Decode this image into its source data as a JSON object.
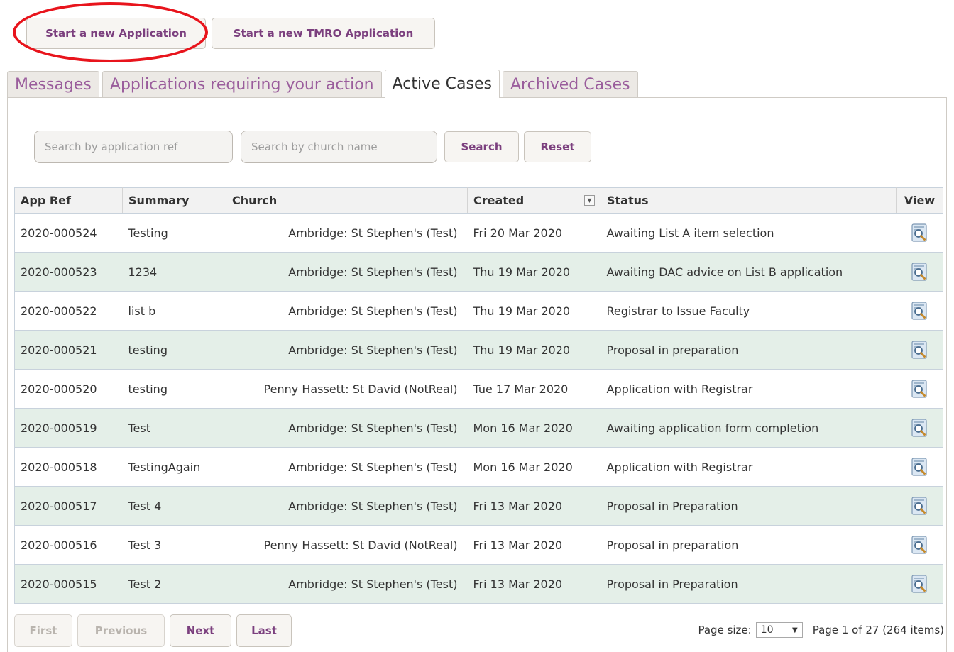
{
  "toolbar": {
    "new_application": "Start a new Application",
    "new_tmro_application": "Start a new TMRO Application"
  },
  "tabs": [
    {
      "label": "Messages",
      "active": false
    },
    {
      "label": "Applications requiring your action",
      "active": false
    },
    {
      "label": "Active Cases",
      "active": true
    },
    {
      "label": "Archived Cases",
      "active": false
    }
  ],
  "search": {
    "app_ref_placeholder": "Search by application ref",
    "church_placeholder": "Search by church name",
    "search_label": "Search",
    "reset_label": "Reset"
  },
  "table": {
    "columns": [
      "App Ref",
      "Summary",
      "Church",
      "Created",
      "Status",
      "View"
    ],
    "rows": [
      {
        "ref": "2020-000524",
        "summary": "Testing",
        "church": "Ambridge: St Stephen's (Test)",
        "created": "Fri 20 Mar 2020",
        "status": "Awaiting List A item selection"
      },
      {
        "ref": "2020-000523",
        "summary": "1234",
        "church": "Ambridge: St Stephen's (Test)",
        "created": "Thu 19 Mar 2020",
        "status": "Awaiting DAC advice on List B application"
      },
      {
        "ref": "2020-000522",
        "summary": "list b",
        "church": "Ambridge: St Stephen's (Test)",
        "created": "Thu 19 Mar 2020",
        "status": "Registrar to Issue Faculty"
      },
      {
        "ref": "2020-000521",
        "summary": "testing",
        "church": "Ambridge: St Stephen's (Test)",
        "created": "Thu 19 Mar 2020",
        "status": "Proposal in preparation"
      },
      {
        "ref": "2020-000520",
        "summary": "testing",
        "church": "Penny Hassett: St David (NotReal)",
        "created": "Tue 17 Mar 2020",
        "status": "Application with Registrar"
      },
      {
        "ref": "2020-000519",
        "summary": "Test",
        "church": "Ambridge: St Stephen's (Test)",
        "created": "Mon 16 Mar 2020",
        "status": "Awaiting application form completion"
      },
      {
        "ref": "2020-000518",
        "summary": "TestingAgain",
        "church": "Ambridge: St Stephen's (Test)",
        "created": "Mon 16 Mar 2020",
        "status": "Application with Registrar"
      },
      {
        "ref": "2020-000517",
        "summary": "Test 4",
        "church": "Ambridge: St Stephen's (Test)",
        "created": "Fri 13 Mar 2020",
        "status": "Proposal in Preparation"
      },
      {
        "ref": "2020-000516",
        "summary": "Test 3",
        "church": "Penny Hassett: St David (NotReal)",
        "created": "Fri 13 Mar 2020",
        "status": "Proposal in preparation"
      },
      {
        "ref": "2020-000515",
        "summary": "Test 2",
        "church": "Ambridge: St Stephen's (Test)",
        "created": "Fri 13 Mar 2020",
        "status": "Proposal in Preparation"
      }
    ]
  },
  "pager": {
    "first": "First",
    "previous": "Previous",
    "next": "Next",
    "last": "Last",
    "page_size_label": "Page size:",
    "page_size_value": "10",
    "page_info": "Page 1 of 27 (264 items)"
  },
  "icons": {
    "sort": "sort-dropdown-icon",
    "view": "magnifier-document-icon"
  },
  "colors": {
    "accent": "#7b3f7e",
    "tab_inactive_text": "#9a5d9c",
    "row_alt": "#e4efe8",
    "highlight": "#e8141c"
  }
}
